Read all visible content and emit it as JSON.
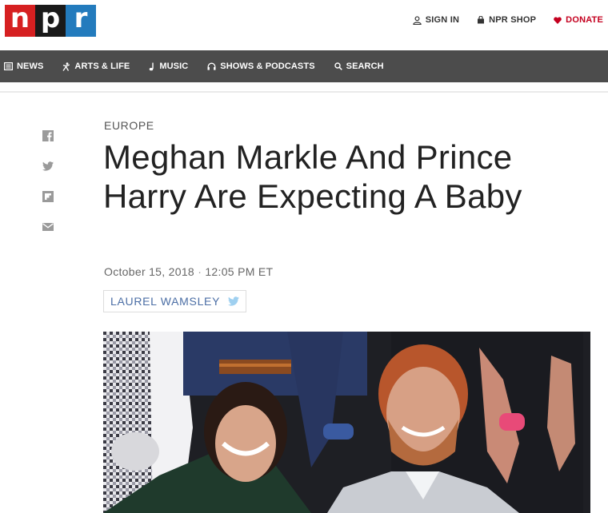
{
  "logo": {
    "letters": [
      "n",
      "p",
      "r"
    ],
    "colors": [
      "#d62021",
      "#1a1a1a",
      "#237bbd"
    ]
  },
  "utility_nav": {
    "sign_in": "SIGN IN",
    "shop": "NPR SHOP",
    "donate": "DONATE"
  },
  "main_nav": [
    {
      "label": "NEWS",
      "icon": "news-icon"
    },
    {
      "label": "ARTS & LIFE",
      "icon": "arts-life-icon"
    },
    {
      "label": "MUSIC",
      "icon": "music-note-icon"
    },
    {
      "label": "SHOWS & PODCASTS",
      "icon": "headphones-icon"
    },
    {
      "label": "SEARCH",
      "icon": "search-icon"
    }
  ],
  "share_icons": [
    "facebook-icon",
    "twitter-icon",
    "flipboard-icon",
    "email-icon"
  ],
  "article": {
    "section": "EUROPE",
    "headline": "Meghan Markle And Prince Harry Are Expecting A Baby",
    "date": "October 15, 2018",
    "time": "12:05 PM ET",
    "author": "LAUREL WAMSLEY"
  },
  "colors": {
    "nav_bg": "#4c4c4c",
    "donate_red": "#c4001f",
    "byline_blue": "#4b6ea5",
    "twitter_blue": "#9fd0f0"
  }
}
